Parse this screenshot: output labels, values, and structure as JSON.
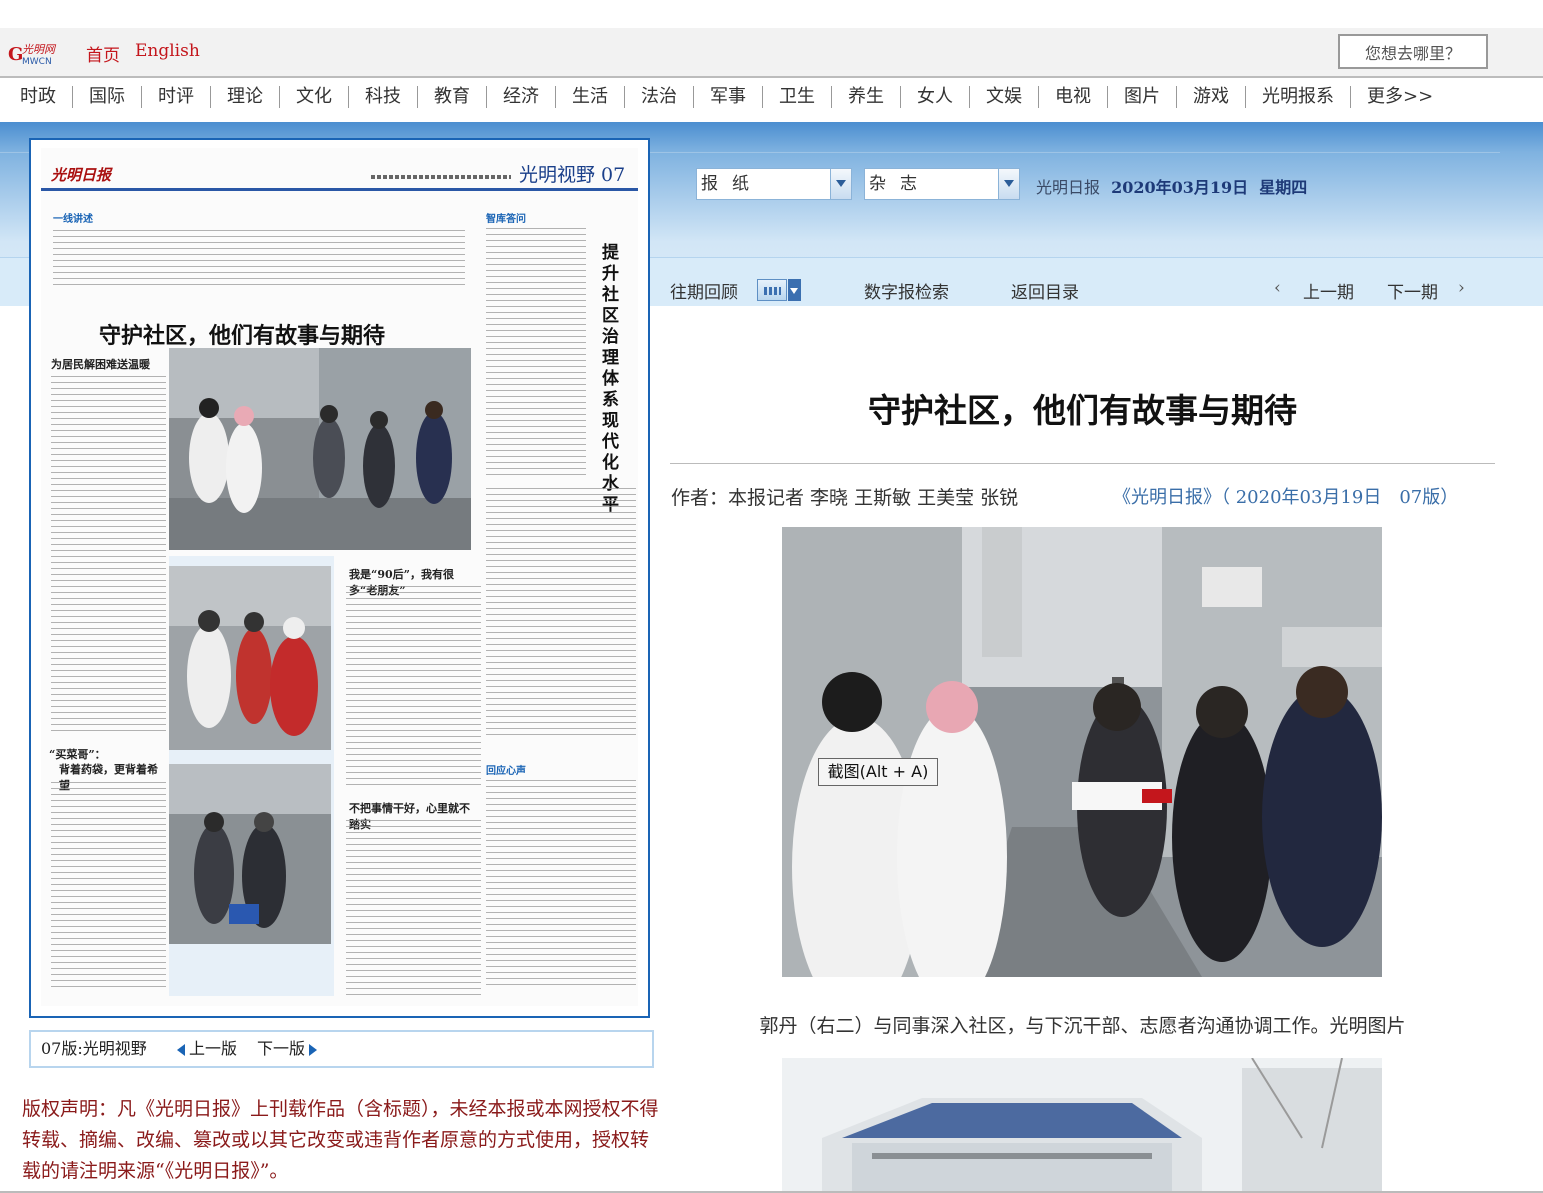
{
  "header": {
    "home": "首页",
    "english": "English",
    "where_button": "您想去哪里？"
  },
  "nav": [
    "时政",
    "国际",
    "时评",
    "理论",
    "文化",
    "科技",
    "教育",
    "经济",
    "生活",
    "法治",
    "军事",
    "卫生",
    "养生",
    "女人",
    "文娱",
    "电视",
    "图片",
    "游戏",
    "光明报系",
    "更多>>"
  ],
  "selector": {
    "newspaper": "报纸",
    "magazine": "杂志",
    "paper_name": "光明日报",
    "date": "2020年03月19日",
    "weekday": "星期四"
  },
  "toolbar": {
    "archive": "往期回顾",
    "search": "数字报检索",
    "back": "返回目录",
    "prev_issue": "上一期",
    "next_issue": "下一期",
    "prev_glyph": "‹",
    "next_glyph": "›"
  },
  "newspaper_page": {
    "masthead": "光明日报",
    "section": "光明视野",
    "page_no": "07",
    "headline": "守护社区，他们有故事与期待",
    "vertical_headline": "提升社区治理体系现代化水平",
    "sub1": "为居民解困难送温暖",
    "sub2": "我是“90后”，我有很多“老朋友”",
    "sub3": "“买菜哥”：",
    "sub3b": "背着药袋，更背着希望",
    "sub4": "不把事情干好，心里就不踏实",
    "tag1": "一线讲述",
    "tag2": "智库答问",
    "tag3": "回应心声"
  },
  "pagebar": {
    "label": "07版:光明视野",
    "prev": "上一版",
    "next": "下一版"
  },
  "copyright": "版权声明：凡《光明日报》上刊载作品（含标题），未经本报或本网授权不得转载、摘编、改编、篡改或以其它改变或违背作者原意的方式使用，授权转载的请注明来源“《光明日报》”。",
  "article": {
    "title": "守护社区，他们有故事与期待",
    "byline": "作者：本报记者 李晓 王斯敏 王美莹 张锐",
    "source": "《光明日报》（ 2020年03月19日　07版）",
    "caption": "郭丹（右二）与同事深入社区，与下沉干部、志愿者沟通协调工作。光明图片",
    "tooltip": "截图(Alt + A)"
  },
  "colors": {
    "brand_red": "#c4161c",
    "link_blue": "#3a6ea8",
    "band_blue": "#4b8ed0",
    "copyright_red": "#8a1a1a"
  }
}
